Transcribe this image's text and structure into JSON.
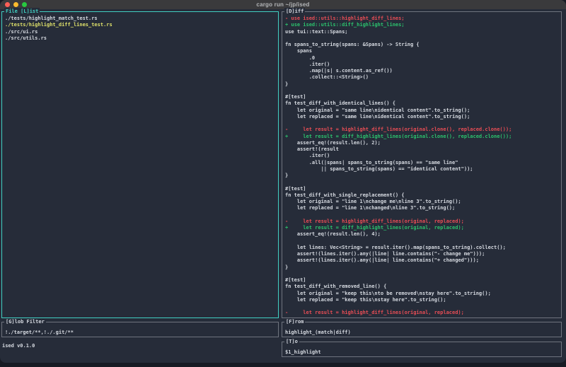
{
  "window": {
    "title": "cargo run ~/jp/ised"
  },
  "colors": {
    "bg": "#262c39",
    "desktop": "#171b24",
    "titlebar_bg": "#3a3a3c",
    "titlebar_fg": "#b4b6b8",
    "fg": "#d6dae1",
    "accent_cyan": "#41d0c3",
    "border_gray": "#6f747e",
    "selected_yellow": "#dee06a",
    "diff_del_red": "#e84d55",
    "diff_add_green": "#2cc16d",
    "light_red": "#ff5f57",
    "light_yellow": "#febc2e",
    "light_green": "#28c840"
  },
  "file_list": {
    "title": "File [L]ist",
    "items": [
      {
        "label": "./tests/highlight_match_test.rs",
        "selected": false
      },
      {
        "label": "./tests/highlight_diff_lines_test.rs",
        "selected": true
      },
      {
        "label": "./src/ui.rs",
        "selected": false
      },
      {
        "label": "./src/utils.rs",
        "selected": false
      }
    ]
  },
  "diff": {
    "title": "[D]iff",
    "lines": [
      {
        "type": "del",
        "text": "- use ised::utils::highlight_diff_lines;"
      },
      {
        "type": "add",
        "text": "+ use ised::utils::diff_highlight_lines;"
      },
      {
        "type": "ctx",
        "text": "use tui::text::Spans;"
      },
      {
        "type": "ctx",
        "text": ""
      },
      {
        "type": "ctx",
        "text": "fn spans_to_string(spans: &Spans) -> String {"
      },
      {
        "type": "ctx",
        "text": "    spans"
      },
      {
        "type": "ctx",
        "text": "        .0"
      },
      {
        "type": "ctx",
        "text": "        .iter()"
      },
      {
        "type": "ctx",
        "text": "        .map(|s| s.content.as_ref())"
      },
      {
        "type": "ctx",
        "text": "        .collect::<String>()"
      },
      {
        "type": "ctx",
        "text": "}"
      },
      {
        "type": "ctx",
        "text": ""
      },
      {
        "type": "ctx",
        "text": "#[test]"
      },
      {
        "type": "ctx",
        "text": "fn test_diff_with_identical_lines() {"
      },
      {
        "type": "ctx",
        "text": "    let original = \"same line\\nidentical content\".to_string();"
      },
      {
        "type": "ctx",
        "text": "    let replaced = \"same line\\nidentical content\".to_string();"
      },
      {
        "type": "ctx",
        "text": ""
      },
      {
        "type": "del",
        "text": "-     let result = highlight_diff_lines(original.clone(), replaced.clone());"
      },
      {
        "type": "add",
        "text": "+     let result = diff_highlight_lines(original.clone(), replaced.clone());"
      },
      {
        "type": "ctx",
        "text": "    assert_eq!(result.len(), 2);"
      },
      {
        "type": "ctx",
        "text": "    assert!(result"
      },
      {
        "type": "ctx",
        "text": "        .iter()"
      },
      {
        "type": "ctx",
        "text": "        .all(|spans| spans_to_string(spans) == \"same line\""
      },
      {
        "type": "ctx",
        "text": "            || spans_to_string(spans) == \"identical content\"));"
      },
      {
        "type": "ctx",
        "text": "}"
      },
      {
        "type": "ctx",
        "text": ""
      },
      {
        "type": "ctx",
        "text": "#[test]"
      },
      {
        "type": "ctx",
        "text": "fn test_diff_with_single_replacement() {"
      },
      {
        "type": "ctx",
        "text": "    let original = \"line 1\\nchange me\\nline 3\".to_string();"
      },
      {
        "type": "ctx",
        "text": "    let replaced = \"line 1\\nchanged\\nline 3\".to_string();"
      },
      {
        "type": "ctx",
        "text": ""
      },
      {
        "type": "del",
        "text": "-     let result = highlight_diff_lines(original, replaced);"
      },
      {
        "type": "add",
        "text": "+     let result = diff_highlight_lines(original, replaced);"
      },
      {
        "type": "ctx",
        "text": "    assert_eq!(result.len(), 4);"
      },
      {
        "type": "ctx",
        "text": ""
      },
      {
        "type": "ctx",
        "text": "    let lines: Vec<String> = result.iter().map(spans_to_string).collect();"
      },
      {
        "type": "ctx",
        "text": "    assert!(lines.iter().any(|line| line.contains(\"- change me\")));"
      },
      {
        "type": "ctx",
        "text": "    assert!(lines.iter().any(|line| line.contains(\"+ changed\")));"
      },
      {
        "type": "ctx",
        "text": "}"
      },
      {
        "type": "ctx",
        "text": ""
      },
      {
        "type": "ctx",
        "text": "#[test]"
      },
      {
        "type": "ctx",
        "text": "fn test_diff_with_removed_line() {"
      },
      {
        "type": "ctx",
        "text": "    let original = \"keep this\\nto be removed\\nstay here\".to_string();"
      },
      {
        "type": "ctx",
        "text": "    let replaced = \"keep this\\nstay here\".to_string();"
      },
      {
        "type": "ctx",
        "text": ""
      },
      {
        "type": "del",
        "text": "-     let result = highlight_diff_lines(original, replaced);"
      }
    ]
  },
  "glob_filter": {
    "title": "[G]lob Filter",
    "value": "!./target/**,!./.git/**"
  },
  "from": {
    "title": "[F]rom",
    "value": "highlight_(match|diff)"
  },
  "to": {
    "title": "[T]o",
    "value": "$1_highlight"
  },
  "status": {
    "text": "ised v0.1.0"
  }
}
